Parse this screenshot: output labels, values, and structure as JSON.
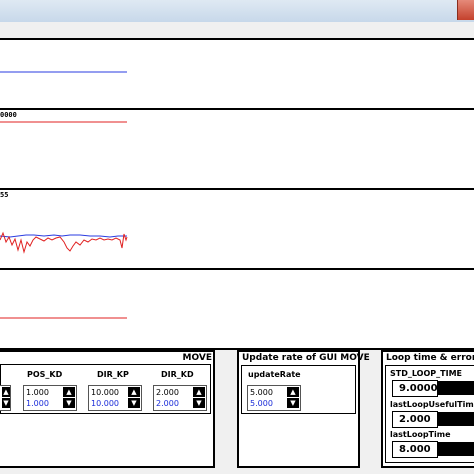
{
  "plots": [
    {
      "label": ""
    },
    {
      "label": "0000"
    },
    {
      "label": "55"
    },
    {
      "label": ""
    }
  ],
  "move_section": {
    "title": "MOVE",
    "fields": [
      {
        "label": "",
        "value": "",
        "value2": ""
      },
      {
        "label": "POS_KD",
        "value": "1.000",
        "value2": "1.000"
      },
      {
        "label": "DIR_KP",
        "value": "10.000",
        "value2": "10.000"
      },
      {
        "label": "DIR_KD",
        "value": "2.000",
        "value2": "2.000"
      }
    ]
  },
  "gui_section": {
    "title": "Update rate of GUI  MOVE",
    "field": {
      "label": "updateRate",
      "value": "5.000",
      "value2": "5.000"
    }
  },
  "loop_section": {
    "title": "Loop time & error",
    "fields": [
      {
        "label": "STD_LOOP_TIME",
        "value": "9.0000"
      },
      {
        "label": "lastLoopUsefulTime",
        "value": "2.000"
      },
      {
        "label": "lastLoopTime",
        "value": "8.000"
      }
    ]
  },
  "colors": {
    "blue": "#2a3be0",
    "red": "#e02020"
  },
  "icons": {
    "up": "triangle-up-icon",
    "down": "triangle-down-icon",
    "close": "close-icon"
  }
}
